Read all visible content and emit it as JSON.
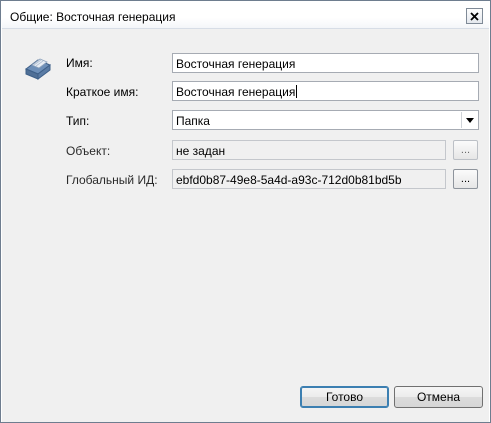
{
  "window": {
    "title": "Общие: Восточная генерация",
    "close_symbol": "close-icon"
  },
  "form": {
    "app_icon": "eraser-tag-icon",
    "name": {
      "label": "Имя:",
      "value": "Восточная генерация"
    },
    "short_name": {
      "label": "Краткое имя:",
      "value": "Восточная генерация"
    },
    "type": {
      "label": "Тип:",
      "value": "Папка",
      "arrow_icon": "dropdown-arrow-icon"
    },
    "object": {
      "label": "Объект:",
      "value": "не задан",
      "browse_label": "..."
    },
    "global_id": {
      "label": "Глобальный ИД:",
      "value": "ebfd0b87-49e8-5a4d-a93c-712d0b81bd5b",
      "browse_label": "..."
    }
  },
  "buttons": {
    "ok": "Готово",
    "cancel": "Отмена"
  }
}
